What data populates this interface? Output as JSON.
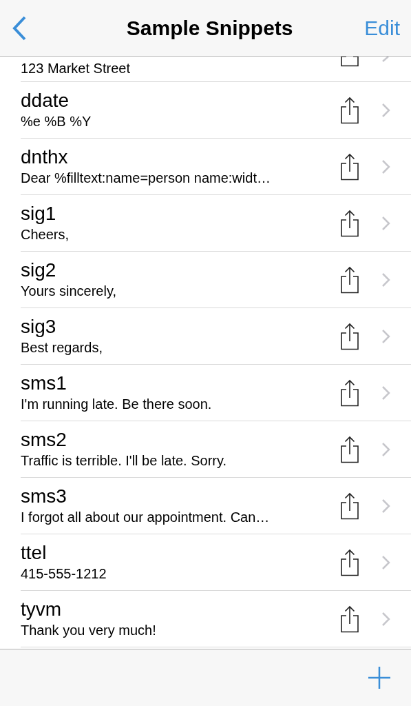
{
  "nav": {
    "title": "Sample Snippets",
    "edit": "Edit"
  },
  "rows": [
    {
      "kind": "partial",
      "subtitle": "123 Market Street"
    },
    {
      "kind": "full",
      "title": "ddate",
      "subtitle": "%e %B %Y"
    },
    {
      "kind": "full",
      "title": "dnthx",
      "subtitle": "Dear %filltext:name=person name:widt…"
    },
    {
      "kind": "full",
      "title": "sig1",
      "subtitle": "Cheers,"
    },
    {
      "kind": "full",
      "title": "sig2",
      "subtitle": "Yours sincerely,"
    },
    {
      "kind": "full",
      "title": "sig3",
      "subtitle": "Best regards,"
    },
    {
      "kind": "full",
      "title": "sms1",
      "subtitle": "I'm running late. Be there soon."
    },
    {
      "kind": "full",
      "title": "sms2",
      "subtitle": "Traffic is terrible. I'll be late. Sorry."
    },
    {
      "kind": "full",
      "title": "sms3",
      "subtitle": "I forgot all about our appointment. Can…"
    },
    {
      "kind": "full",
      "title": "ttel",
      "subtitle": "415-555-1212"
    },
    {
      "kind": "full",
      "title": "tyvm",
      "subtitle": "Thank you very much!"
    }
  ]
}
